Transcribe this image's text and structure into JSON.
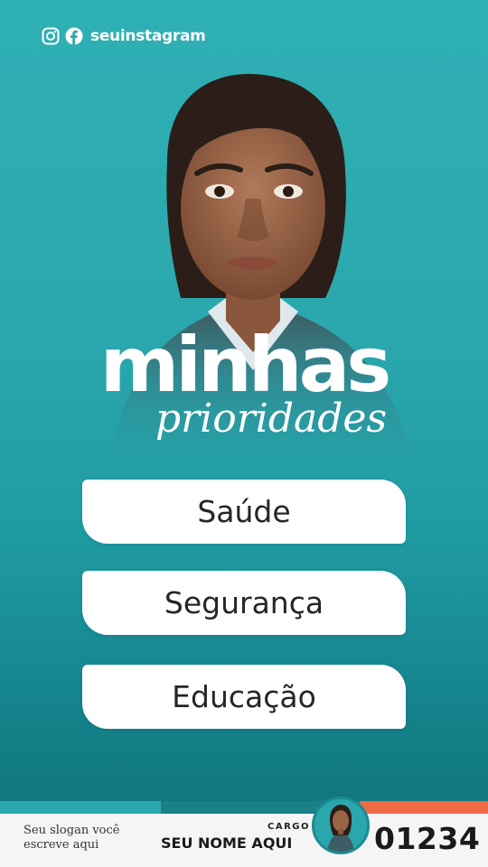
{
  "social": {
    "handle": "seuinstagram",
    "icons": [
      "instagram-icon",
      "facebook-icon"
    ]
  },
  "headline": {
    "main": "minhas",
    "sub": "prioridades"
  },
  "priorities": [
    {
      "label": "Saúde"
    },
    {
      "label": "Segurança"
    },
    {
      "label": "Educação"
    }
  ],
  "footer": {
    "slogan": "Seu slogan você escreve aqui",
    "cargo": "CARGO",
    "name": "SEU NOME AQUI",
    "number": "01234"
  },
  "colors": {
    "background_top": "#2fb0b5",
    "background_bottom": "#0f6f78",
    "accent_teal": "#2ba9ae",
    "accent_orange": "#f06a45",
    "card": "#ffffff"
  }
}
